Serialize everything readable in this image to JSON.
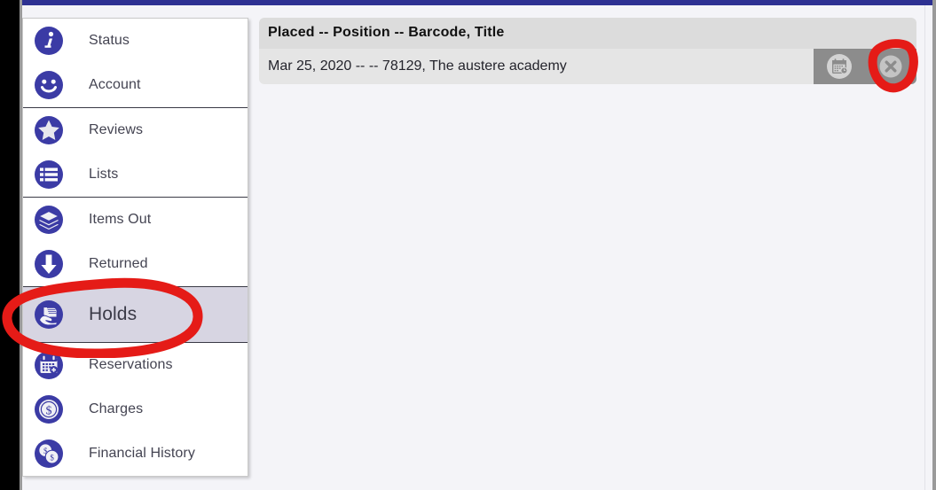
{
  "theme": {
    "brand_purple": "#2e3192",
    "icon_blue": "#3b3ba5",
    "sidebar_active_bg": "#d7d5e2",
    "header_row_bg": "#dcdcdc",
    "data_row_bg": "#e5e5e5",
    "action_bar_bg": "#8c8c8c",
    "annotation_red": "#e51b17",
    "page_bg": "#f4f4f8"
  },
  "sidebar": {
    "groups": [
      {
        "items": [
          {
            "label": "Status",
            "icon": "info-circle-icon",
            "active": false
          },
          {
            "label": "Account",
            "icon": "smiley-face-icon",
            "active": false
          }
        ]
      },
      {
        "items": [
          {
            "label": "Reviews",
            "icon": "star-circle-icon",
            "active": false
          },
          {
            "label": "Lists",
            "icon": "list-circle-icon",
            "active": false
          }
        ]
      },
      {
        "items": [
          {
            "label": "Items Out",
            "icon": "book-stack-icon",
            "active": false
          },
          {
            "label": "Returned",
            "icon": "down-arrow-circle-icon",
            "active": false
          }
        ]
      },
      {
        "items": [
          {
            "label": "Holds",
            "icon": "hand-holding-book-icon",
            "active": true
          }
        ]
      },
      {
        "items": [
          {
            "label": "Reservations",
            "icon": "calendar-circle-icon",
            "active": false
          },
          {
            "label": "Charges",
            "icon": "dollar-coin-icon",
            "active": false
          },
          {
            "label": "Financial History",
            "icon": "two-coins-icon",
            "active": false
          }
        ]
      }
    ]
  },
  "main": {
    "holds_table": {
      "header": "Placed -- Position -- Barcode, Title",
      "rows": [
        {
          "text": "Mar 25, 2020 -- -- 78129, The austere academy",
          "placed": "Mar 25, 2020",
          "position": "--",
          "barcode": "78129",
          "title": "The austere academy",
          "actions": [
            {
              "name": "suspend-hold-button",
              "icon": "calendar-clock-icon"
            },
            {
              "name": "cancel-hold-button",
              "icon": "cancel-x-circle-icon"
            }
          ]
        }
      ]
    }
  },
  "annotations": [
    {
      "name": "holds-nav-highlight",
      "shape": "ellipse",
      "color": "#e51b17"
    },
    {
      "name": "cancel-button-highlight",
      "shape": "ellipse",
      "color": "#e51b17"
    }
  ]
}
